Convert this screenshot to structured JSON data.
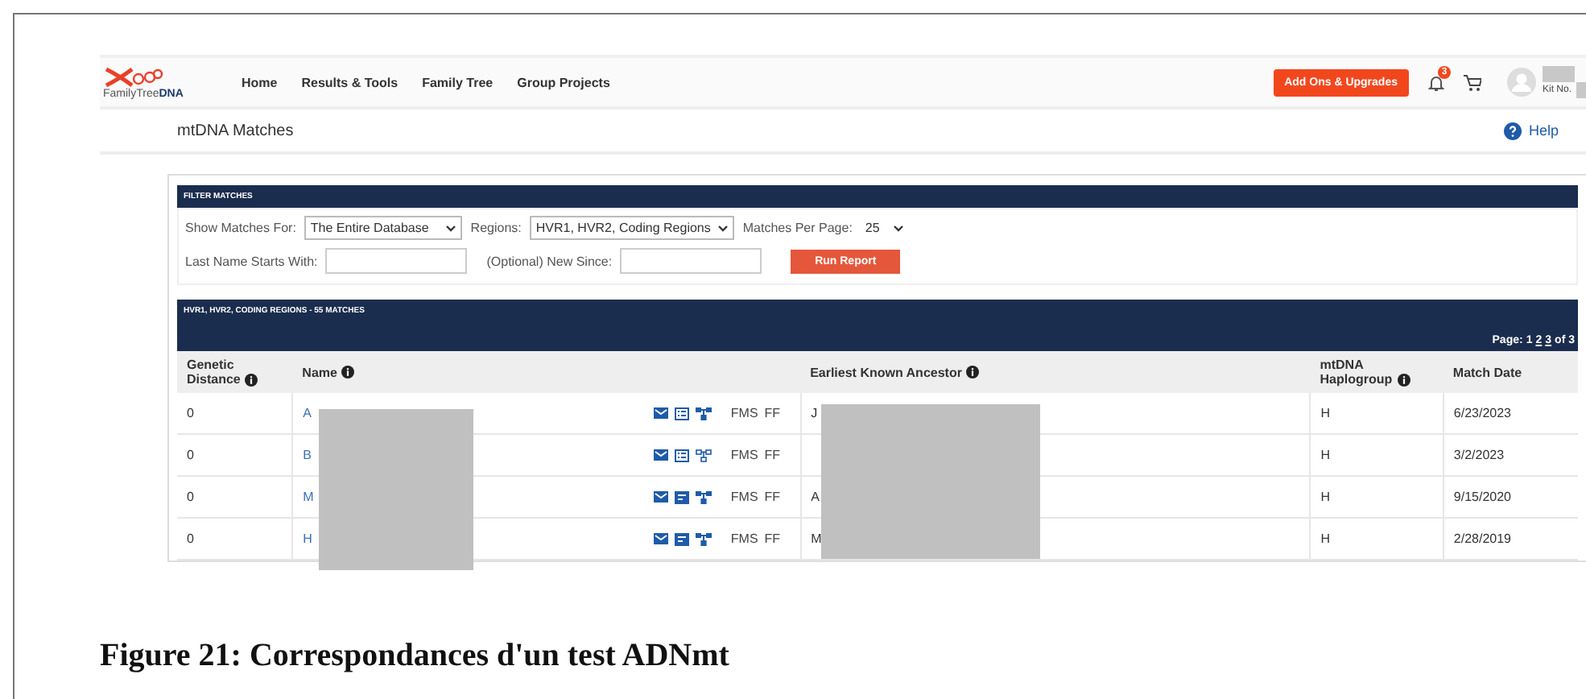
{
  "header": {
    "logo": {
      "word1": "FamilyTree",
      "word2": "DNA"
    },
    "nav": [
      {
        "label": "Home"
      },
      {
        "label": "Results & Tools"
      },
      {
        "label": "Family Tree"
      },
      {
        "label": "Group Projects"
      }
    ],
    "upgrade_button": "Add Ons & Upgrades",
    "notification_count": "3",
    "kit_label": "Kit No."
  },
  "page": {
    "title": "mtDNA Matches",
    "help": "Help"
  },
  "filter": {
    "title": "FILTER MATCHES",
    "show_for": {
      "label": "Show Matches For:",
      "value": "The Entire Database"
    },
    "regions": {
      "label": "Regions:",
      "value": "HVR1, HVR2, Coding Regions"
    },
    "per_page": {
      "label": "Matches Per Page:",
      "value": "25"
    },
    "last_name": {
      "label": "Last Name Starts With:"
    },
    "new_since": {
      "label": "(Optional) New Since:"
    },
    "run_button": "Run Report"
  },
  "results": {
    "title": "HVR1, HVR2, CODING REGIONS - 55 MATCHES",
    "pagination": {
      "label": "Page:",
      "pages": [
        {
          "label": "1",
          "selected": true
        },
        {
          "label": "2",
          "selected": false
        },
        {
          "label": "3",
          "selected": false
        }
      ],
      "total": "of 3"
    },
    "columns": [
      {
        "label": "Genetic Distance",
        "info": true
      },
      {
        "label": "Name",
        "info": true
      },
      {
        "label": "Earliest Known Ancestor",
        "info": true
      },
      {
        "label": "mtDNA Haplogroup",
        "info": true
      },
      {
        "label": "Match Date",
        "info": false
      }
    ],
    "rows": [
      {
        "distance": "0",
        "name": "A",
        "has_notes": false,
        "has_tree": true,
        "fms": "FMS",
        "ff": "FF",
        "ancestor": "J",
        "haplogroup": "H",
        "date": "6/23/2023"
      },
      {
        "distance": "0",
        "name": "B",
        "has_notes": false,
        "has_tree": false,
        "fms": "FMS",
        "ff": "FF",
        "ancestor": "",
        "haplogroup": "H",
        "date": "3/2/2023"
      },
      {
        "distance": "0",
        "name": "M",
        "has_notes": true,
        "has_tree": true,
        "fms": "FMS",
        "ff": "FF",
        "ancestor": "A",
        "haplogroup": "H",
        "date": "9/15/2020"
      },
      {
        "distance": "0",
        "name": "H",
        "has_notes": true,
        "has_tree": true,
        "fms": "FMS",
        "ff": "FF",
        "ancestor": "M",
        "haplogroup": "H",
        "date": "2/28/2019"
      }
    ]
  },
  "caption": "Figure 21: Correspondances d'un test ADNmt"
}
